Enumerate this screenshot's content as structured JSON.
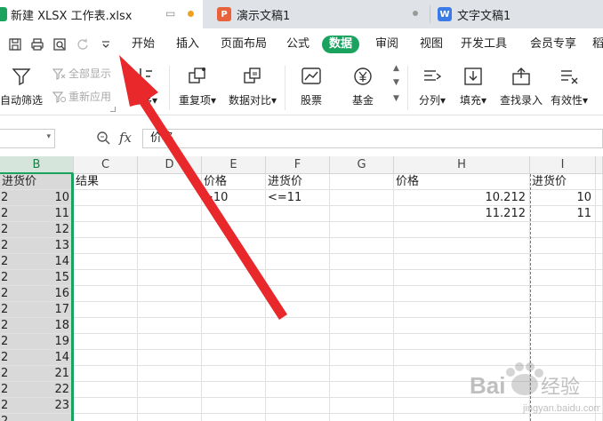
{
  "tabs": [
    {
      "label": "新建 XLSX 工作表.xlsx",
      "icon": "spreadsheet-icon",
      "color": "#1aa35f"
    },
    {
      "label": "演示文稿1",
      "icon": "presentation-icon",
      "color": "#e8623b"
    },
    {
      "label": "文字文稿1",
      "icon": "document-icon",
      "color": "#3b7be8"
    }
  ],
  "tab_letters": {
    "presentation": "P",
    "document": "W"
  },
  "menu": {
    "items": [
      "开始",
      "插入",
      "页面布局",
      "公式",
      "数据",
      "审阅",
      "视图",
      "开发工具",
      "会员专享",
      "稻"
    ],
    "active_item": "数据"
  },
  "ribbon": {
    "auto_filter": "自动筛选",
    "show_all": "全部显示",
    "reapply": "重新应用",
    "sort": "排序",
    "duplicates": "重复项",
    "data_compare": "数据对比",
    "stock": "股票",
    "fund": "基金",
    "split": "分列",
    "fill": "填充",
    "find_input": "查找录入",
    "validity": "有效性",
    "dropdown_mark": "▾"
  },
  "formula_bar": {
    "fx_label": "fx",
    "formula_text": "价格"
  },
  "columns": [
    "B",
    "C",
    "D",
    "E",
    "F",
    "G",
    "H",
    "I"
  ],
  "selected_column": "B",
  "grid": {
    "row_prefix": [
      "2",
      "2",
      "2",
      "2",
      "2",
      "2",
      "2",
      "2",
      "2",
      "2",
      "2",
      "2",
      "2",
      "2",
      "2"
    ],
    "row1": {
      "B": "进货价",
      "C": "结果",
      "E": "价格",
      "F": "进货价",
      "H": "价格",
      "I": "进货价"
    },
    "row2": {
      "E": ">10",
      "F": "<=11",
      "H": "10.212",
      "I": "10"
    },
    "row3": {
      "H": "11.212",
      "I": "11"
    },
    "b_values": [
      "10",
      "11",
      "12",
      "13",
      "14",
      "15",
      "16",
      "17",
      "18",
      "19",
      "14",
      "21",
      "22",
      "23"
    ]
  },
  "watermark": {
    "brand": "Bai",
    "text": "经验",
    "sub": "jingyan.baidu.com"
  },
  "colors": {
    "accent": "#1aa35f",
    "arrow": "#e8282b",
    "tab_bg": "#dfe3e8"
  }
}
